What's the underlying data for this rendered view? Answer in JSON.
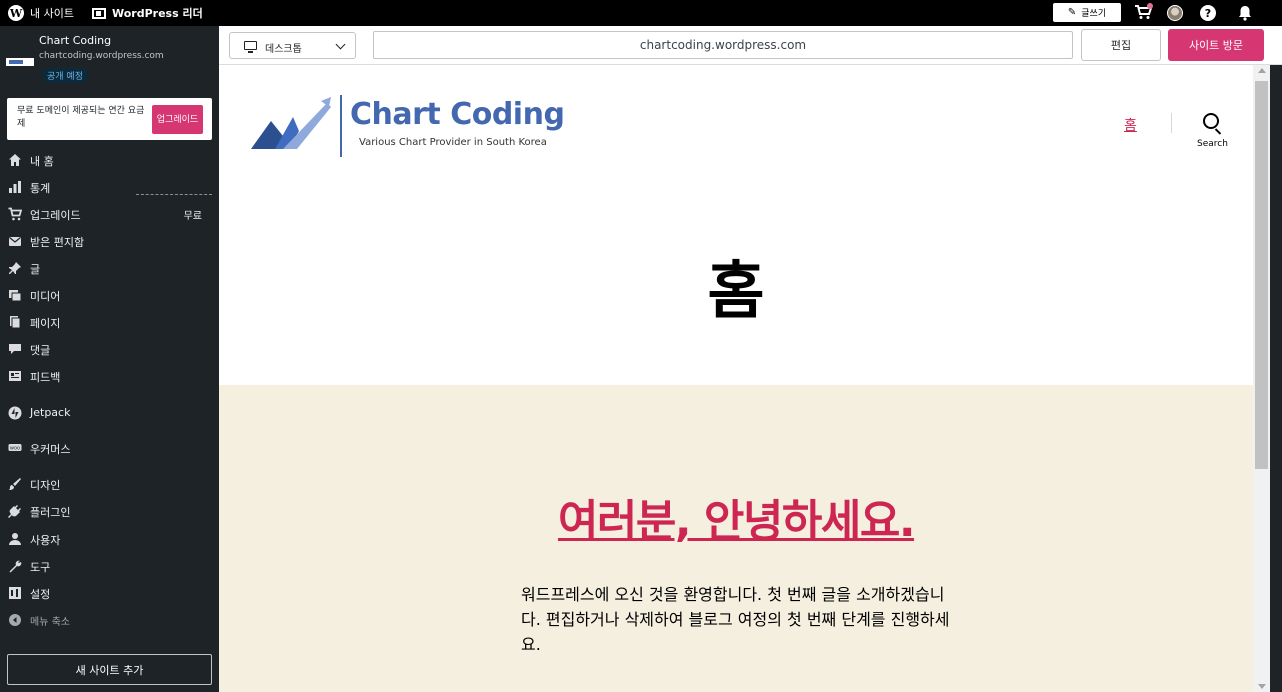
{
  "adminbar": {
    "my_site": "내 사이트",
    "reader": "WordPress 리더",
    "write": "글쓰기",
    "help": "?"
  },
  "site": {
    "name": "Chart Coding",
    "url": "chartcoding.wordpress.com",
    "badge": "공개 예정"
  },
  "upsell": {
    "text": "무료 도메인이 제공되는 연간 요금제",
    "button": "업그레이드"
  },
  "menu": [
    {
      "label": "내 홈",
      "icon": "home-icon"
    },
    {
      "label": "통계",
      "icon": "stats-icon"
    },
    {
      "label": "업그레이드",
      "icon": "cart-icon",
      "extra": "무료"
    },
    {
      "label": "받은 편지함",
      "icon": "mail-icon"
    },
    {
      "label": "글",
      "icon": "pin-icon"
    },
    {
      "label": "미디어",
      "icon": "media-icon"
    },
    {
      "label": "페이지",
      "icon": "pages-icon"
    },
    {
      "label": "댓글",
      "icon": "comment-icon"
    },
    {
      "label": "피드백",
      "icon": "feedback-icon"
    },
    {
      "label": "Jetpack",
      "icon": "jetpack-icon"
    },
    {
      "label": "우커머스",
      "icon": "woo-icon"
    },
    {
      "label": "디자인",
      "icon": "brush-icon"
    },
    {
      "label": "플러그인",
      "icon": "plugin-icon"
    },
    {
      "label": "사용자",
      "icon": "user-icon"
    },
    {
      "label": "도구",
      "icon": "wrench-icon"
    },
    {
      "label": "설정",
      "icon": "settings-icon"
    },
    {
      "label": "메뉴 축소",
      "icon": "collapse-icon"
    }
  ],
  "add_site": "새 사이트 추가",
  "toolbar": {
    "device": "데스크톱",
    "url": "chartcoding.wordpress.com",
    "edit": "편집",
    "visit": "사이트 방문"
  },
  "preview": {
    "logo_title": "Chart Coding",
    "logo_tagline": "Various Chart Provider in South Korea",
    "nav_home": "홈",
    "search_label": "Search",
    "page_heading": "홈",
    "post_title": "여러분, 안녕하세요.",
    "post_body": "워드프레스에 오신 것을 환영합니다. 첫 번째 글을 소개하겠습니다. 편집하거나 삭제하여 블로그 여정의 첫 번째 단계를 진행하세요."
  },
  "colors": {
    "accent": "#d63672",
    "brand": "#4468b0",
    "link": "#cd2653",
    "sidebar_bg": "#1d2327",
    "beige_bg": "#f5efe0"
  }
}
